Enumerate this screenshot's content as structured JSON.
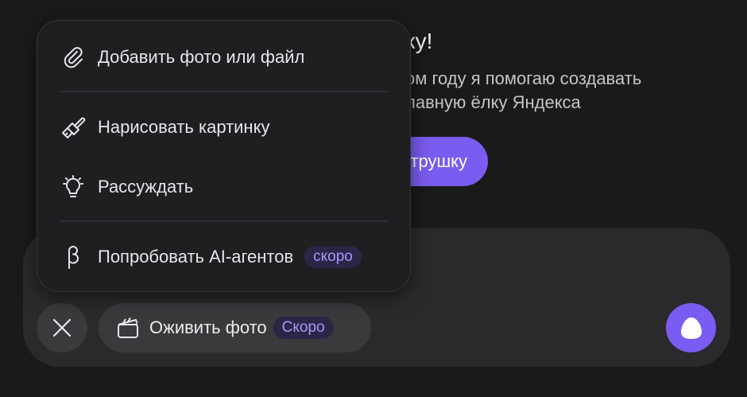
{
  "background": {
    "title": "ку!",
    "line1": "ом году я помогаю создавать",
    "line2": "лавную ёлку Яндекса",
    "button_label": "трушку"
  },
  "menu": {
    "items": [
      {
        "label": "Добавить фото или файл",
        "icon": "paperclip-icon"
      },
      {
        "label": "Нарисовать картинку",
        "icon": "brush-icon"
      },
      {
        "label": "Рассуждать",
        "icon": "lightbulb-icon"
      },
      {
        "label": "Попробовать AI-агентов",
        "icon": "beta-icon",
        "badge": "скоро"
      }
    ]
  },
  "composer": {
    "animate_label": "Оживить фото",
    "animate_badge": "Скоро",
    "close_icon": "close-icon",
    "animate_icon": "clapperboard-icon",
    "alice_icon": "alice-icon"
  },
  "colors": {
    "accent": "#7b5cf0",
    "badge_text": "#a896ff",
    "badge_bg": "#2a2746",
    "background": "#1a1a1a",
    "panel": "#2a2a2c"
  }
}
